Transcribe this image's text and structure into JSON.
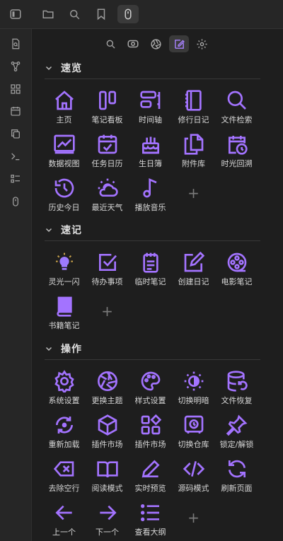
{
  "colors": {
    "accent": "#a373ff",
    "background": "#1e1e1e",
    "sidebar": "#262626"
  },
  "toolbar": {
    "buttons": [
      {
        "icon": "sidebar-toggle-icon"
      },
      {
        "icon": "folder-icon"
      },
      {
        "icon": "search-icon"
      },
      {
        "icon": "bookmark-icon"
      },
      {
        "icon": "mouse-icon"
      }
    ]
  },
  "rail": {
    "icons": [
      "file-search-icon",
      "graph-icon",
      "dashboard-icon",
      "calendar-icon",
      "copy-icon",
      "terminal-icon",
      "list-icon",
      "mouse-icon"
    ]
  },
  "view_tabs": [
    "search-icon",
    "eye-icon",
    "aperture-icon",
    "edit-icon",
    "gear-icon"
  ],
  "sections": [
    {
      "title": "速览",
      "items": [
        {
          "label": "主页",
          "icon": "home-icon"
        },
        {
          "label": "笔记看板",
          "icon": "kanban-icon"
        },
        {
          "label": "时间轴",
          "icon": "timeline-icon"
        },
        {
          "label": "修行日记",
          "icon": "notebook-icon"
        },
        {
          "label": "文件检索",
          "icon": "search-icon"
        },
        {
          "label": "数据视图",
          "icon": "chart-icon"
        },
        {
          "label": "任务日历",
          "icon": "calendar-check-icon"
        },
        {
          "label": "生日簿",
          "icon": "cake-icon"
        },
        {
          "label": "附件库",
          "icon": "files-icon"
        },
        {
          "label": "时光回溯",
          "icon": "calendar-clock-icon"
        },
        {
          "label": "历史今日",
          "icon": "history-icon"
        },
        {
          "label": "最近天气",
          "icon": "weather-icon"
        },
        {
          "label": "播放音乐",
          "icon": "music-icon"
        }
      ],
      "add": "+"
    },
    {
      "title": "速记",
      "items": [
        {
          "label": "灵光一闪",
          "icon": "lightbulb-icon"
        },
        {
          "label": "待办事项",
          "icon": "checkbox-icon"
        },
        {
          "label": "临时笔记",
          "icon": "notepad-icon"
        },
        {
          "label": "创建日记",
          "icon": "pencil-square-icon"
        },
        {
          "label": "电影笔记",
          "icon": "film-reel-icon"
        },
        {
          "label": "书籍笔记",
          "icon": "book-icon"
        }
      ],
      "add": "+"
    },
    {
      "title": "操作",
      "items": [
        {
          "label": "系统设置",
          "icon": "gear-icon"
        },
        {
          "label": "更换主题",
          "icon": "aperture-icon"
        },
        {
          "label": "样式设置",
          "icon": "palette-icon"
        },
        {
          "label": "切换明暗",
          "icon": "sun-moon-icon"
        },
        {
          "label": "文件恢复",
          "icon": "database-restore-icon"
        },
        {
          "label": "重新加载",
          "icon": "reload-icon"
        },
        {
          "label": "插件市场",
          "icon": "cube-icon"
        },
        {
          "label": "插件市场",
          "icon": "apps-icon"
        },
        {
          "label": "切换仓库",
          "icon": "vault-icon"
        },
        {
          "label": "锁定/解锁",
          "icon": "pin-icon"
        },
        {
          "label": "去除空行",
          "icon": "backspace-icon"
        },
        {
          "label": "阅读模式",
          "icon": "open-book-icon"
        },
        {
          "label": "实时预览",
          "icon": "pen-icon"
        },
        {
          "label": "源码模式",
          "icon": "code-icon"
        },
        {
          "label": "刷新页面",
          "icon": "refresh-icon"
        },
        {
          "label": "上一个",
          "icon": "arrow-left-icon"
        },
        {
          "label": "下一个",
          "icon": "arrow-right-icon"
        },
        {
          "label": "查看大纲",
          "icon": "outline-icon"
        }
      ],
      "add": "+"
    }
  ]
}
